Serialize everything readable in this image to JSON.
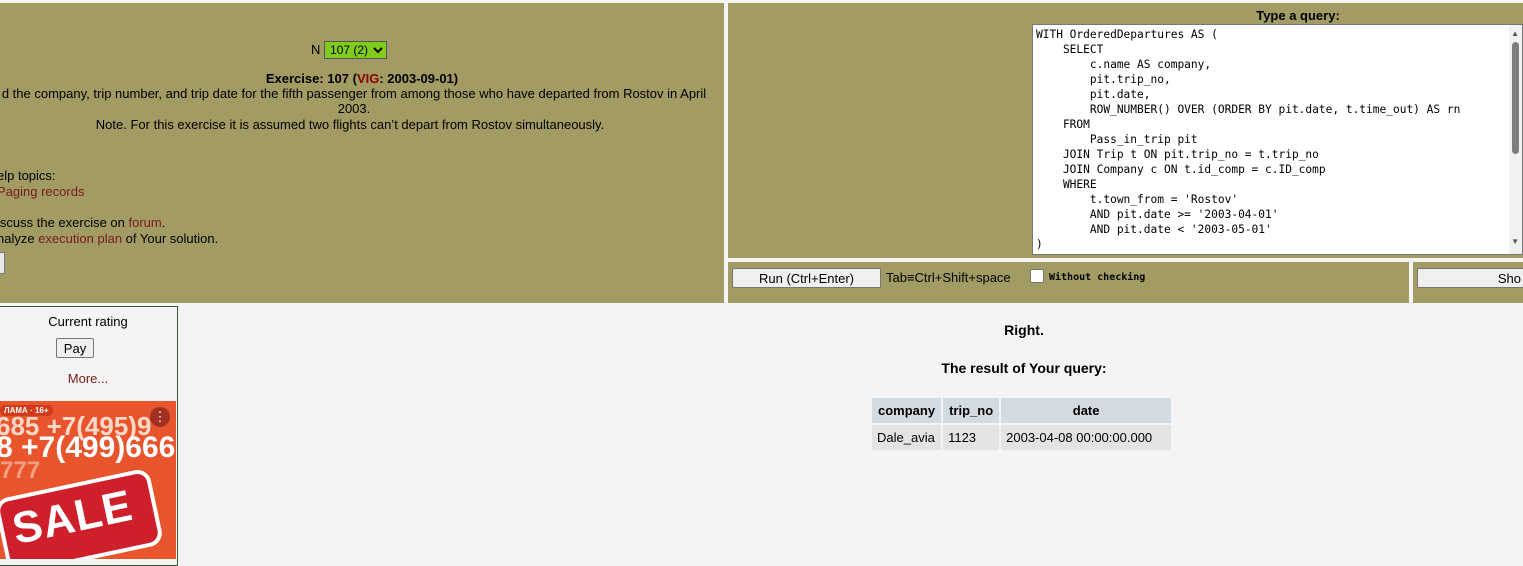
{
  "exercise": {
    "n_label": "N",
    "selected": "107 (2)",
    "title_prefix": "Exercise: 107 (",
    "author": "VIG",
    "title_suffix": ": 2003-09-01)",
    "description": "d the company, trip number, and trip date for the fifth passenger from among those who have departed from Rostov in April 2003.",
    "note": "Note. For this exercise it is assumed two flights can’t depart from Rostov simultaneously."
  },
  "help": {
    "topics_label": "elp topics:",
    "topic_link": "Paging records",
    "discuss_prefix": "iscuss the exercise on ",
    "forum_link": "forum",
    "discuss_suffix": ".",
    "analyze_prefix": "nalyze ",
    "plan_link": "execution plan",
    "analyze_suffix": " of Your solution."
  },
  "query": {
    "label": "Type a query:",
    "text": "WITH OrderedDepartures AS (\n    SELECT\n        c.name AS company,\n        pit.trip_no,\n        pit.date,\n        ROW_NUMBER() OVER (ORDER BY pit.date, t.time_out) AS rn\n    FROM\n        Pass_in_trip pit\n    JOIN Trip t ON pit.trip_no = t.trip_no\n    JOIN Company c ON t.id_comp = c.ID_comp\n    WHERE\n        t.town_from = 'Rostov'\n        AND pit.date >= '2003-04-01'\n        AND pit.date < '2003-05-01'\n)"
  },
  "toolbar": {
    "run_label": "Run (Ctrl+Enter)",
    "tab_hint": "Tab≡Ctrl+Shift+space",
    "without_checking": "Without checking",
    "show_label": "Sho"
  },
  "sidebar": {
    "rating_title": "Current rating",
    "pay_label": "Pay",
    "more_label": "More..."
  },
  "ad": {
    "tag": "ЛАМА · 16+",
    "line1": "685 +7(495)9",
    "line2": "8 +7(499)666",
    "sale": "SALE"
  },
  "result": {
    "status": "Right.",
    "title": "The result of Your query:",
    "columns": [
      "company",
      "trip_no",
      "date"
    ],
    "rows": [
      [
        "Dale_avia",
        "1123",
        "2003-04-08 00:00:00.000"
      ]
    ]
  }
}
